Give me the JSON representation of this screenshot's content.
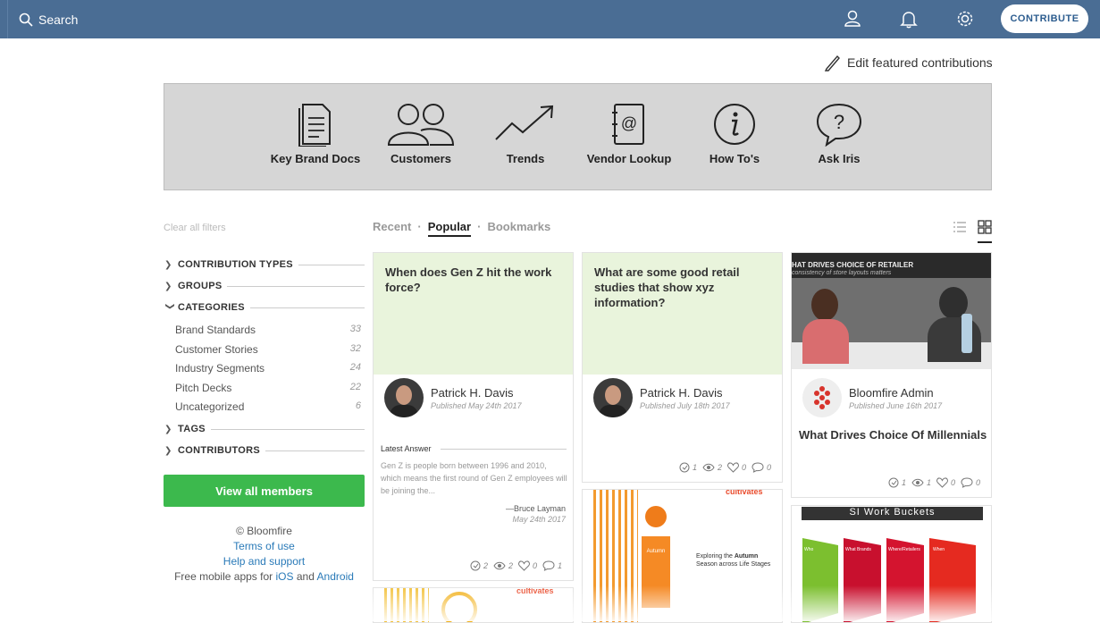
{
  "topbar": {
    "search_label": "Search",
    "contribute_label": "CONTRIBUTE",
    "icons": [
      "user-icon",
      "bell-icon",
      "gear-icon"
    ]
  },
  "edit_featured": "Edit featured contributions",
  "featured": [
    {
      "label": "Key Brand Docs",
      "icon": "document-icon"
    },
    {
      "label": "Customers",
      "icon": "people-icon"
    },
    {
      "label": "Trends",
      "icon": "trend-icon"
    },
    {
      "label": "Vendor Lookup",
      "icon": "address-book-icon"
    },
    {
      "label": "How To's",
      "icon": "info-icon"
    },
    {
      "label": "Ask Iris",
      "icon": "question-bubble-icon"
    }
  ],
  "sidebar": {
    "clear_filters": "Clear all filters",
    "filters": [
      {
        "label": "CONTRIBUTION TYPES",
        "expanded": false
      },
      {
        "label": "GROUPS",
        "expanded": false
      },
      {
        "label": "CATEGORIES",
        "expanded": true
      },
      {
        "label": "TAGS",
        "expanded": false
      },
      {
        "label": "CONTRIBUTORS",
        "expanded": false
      }
    ],
    "categories": [
      {
        "name": "Brand Standards",
        "count": "33"
      },
      {
        "name": "Customer Stories",
        "count": "32"
      },
      {
        "name": "Industry Segments",
        "count": "24"
      },
      {
        "name": "Pitch Decks",
        "count": "22"
      },
      {
        "name": "Uncategorized",
        "count": "6"
      }
    ],
    "view_all": "View all members",
    "copyright": "© Bloomfire",
    "terms": "Terms of use",
    "help": "Help and support",
    "apps_prefix": "Free mobile apps for",
    "ios": "iOS",
    "and": "and",
    "android": "Android"
  },
  "tabs": {
    "recent": "Recent",
    "popular": "Popular",
    "bookmarks": "Bookmarks",
    "sep": "·"
  },
  "cards": [
    {
      "title": "When does Gen Z hit the work force?",
      "author": "Patrick H. Davis",
      "published": "Published May 24th 2017",
      "latest_answer_label": "Latest Answer",
      "latest_answer": "Gen Z is people born between 1996 and 2010, which means the first round of Gen Z employees will be joining the...",
      "answer_by": "—Bruce Layman",
      "answer_date": "May 24th 2017",
      "stats": {
        "answers": "2",
        "views": "2",
        "likes": "0",
        "comments": "1"
      }
    },
    {
      "title": "What are some good retail studies that show xyz information?",
      "author": "Patrick H. Davis",
      "published": "Published July 18th 2017",
      "stats": {
        "answers": "1",
        "views": "2",
        "likes": "0",
        "comments": "0"
      }
    },
    {
      "image_caption": "HAT DRIVES CHOICE OF RETAILER",
      "image_sub": "consistency of store layouts matters",
      "author": "Bloomfire Admin",
      "published": "Published June 16th 2017",
      "title": "What Drives Choice Of Millennials",
      "stats": {
        "answers": "1",
        "views": "1",
        "likes": "0",
        "comments": "0"
      }
    },
    {
      "slide_text_1": "Exploring the",
      "slide_bold": "Autumn",
      "slide_text_2": "Season across Life Stages",
      "brand": "cultivates",
      "ribbon": "Autumn"
    },
    {
      "title": "SI Work Buckets",
      "columns": [
        "Who",
        "What Brands",
        "Where/Retailers",
        "When"
      ]
    },
    {
      "brand": "cultivates"
    }
  ]
}
